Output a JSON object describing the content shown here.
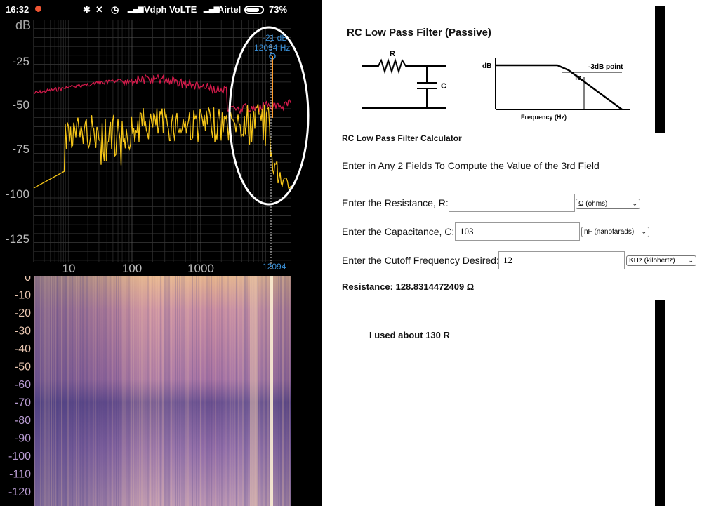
{
  "phone": {
    "status_bar": {
      "time": "16:32",
      "carrier1": "Vdph VoLTE",
      "carrier2": "Airtel",
      "battery": "73%"
    },
    "spectrum": {
      "y_unit": "dB",
      "y_ticks": [
        "-25",
        "-50",
        "-75",
        "-100",
        "-125"
      ],
      "x_ticks": [
        "10",
        "100",
        "1000"
      ],
      "peak_label_db": "-21 dB",
      "peak_label_hz": "12094 Hz",
      "cursor_freq": "12094"
    },
    "spectrogram": {
      "y_ticks": [
        "0",
        "-10",
        "-20",
        "-30",
        "-40",
        "-50",
        "-60",
        "-70",
        "-80",
        "-90",
        "-100",
        "-110",
        "-120"
      ]
    }
  },
  "web": {
    "title": "RC Low Pass Filter (Passive)",
    "schematic": {
      "r_label": "R",
      "c_label": "C"
    },
    "response_graph": {
      "y_label": "dB",
      "fc_label": "fc",
      "point_label": "-3dB point",
      "x_label": "Frequency (Hz)"
    },
    "calculator_heading": "RC Low Pass Filter Calculator",
    "instructions": "Enter in Any 2 Fields To Compute the Value of the 3rd Field",
    "resistance": {
      "label": "Enter the Resistance, R:",
      "value": "",
      "unit": "Ω (ohms)"
    },
    "capacitance": {
      "label": "Enter the Capacitance, C:",
      "value": "103",
      "unit": "nF (nanofarads)"
    },
    "frequency": {
      "label": "Enter the Cutoff Frequency Desired:",
      "value": "12",
      "unit": "KHz (kilohertz)"
    },
    "result": "Resistance: 128.8314472409 Ω",
    "note": "I used about 130 R"
  },
  "colors": {
    "spectrum_red": "#d21a4a",
    "spectrum_yellow": "#f5c518",
    "annotation_white": "#ffffff",
    "peak_blue": "#3a8fd6"
  }
}
